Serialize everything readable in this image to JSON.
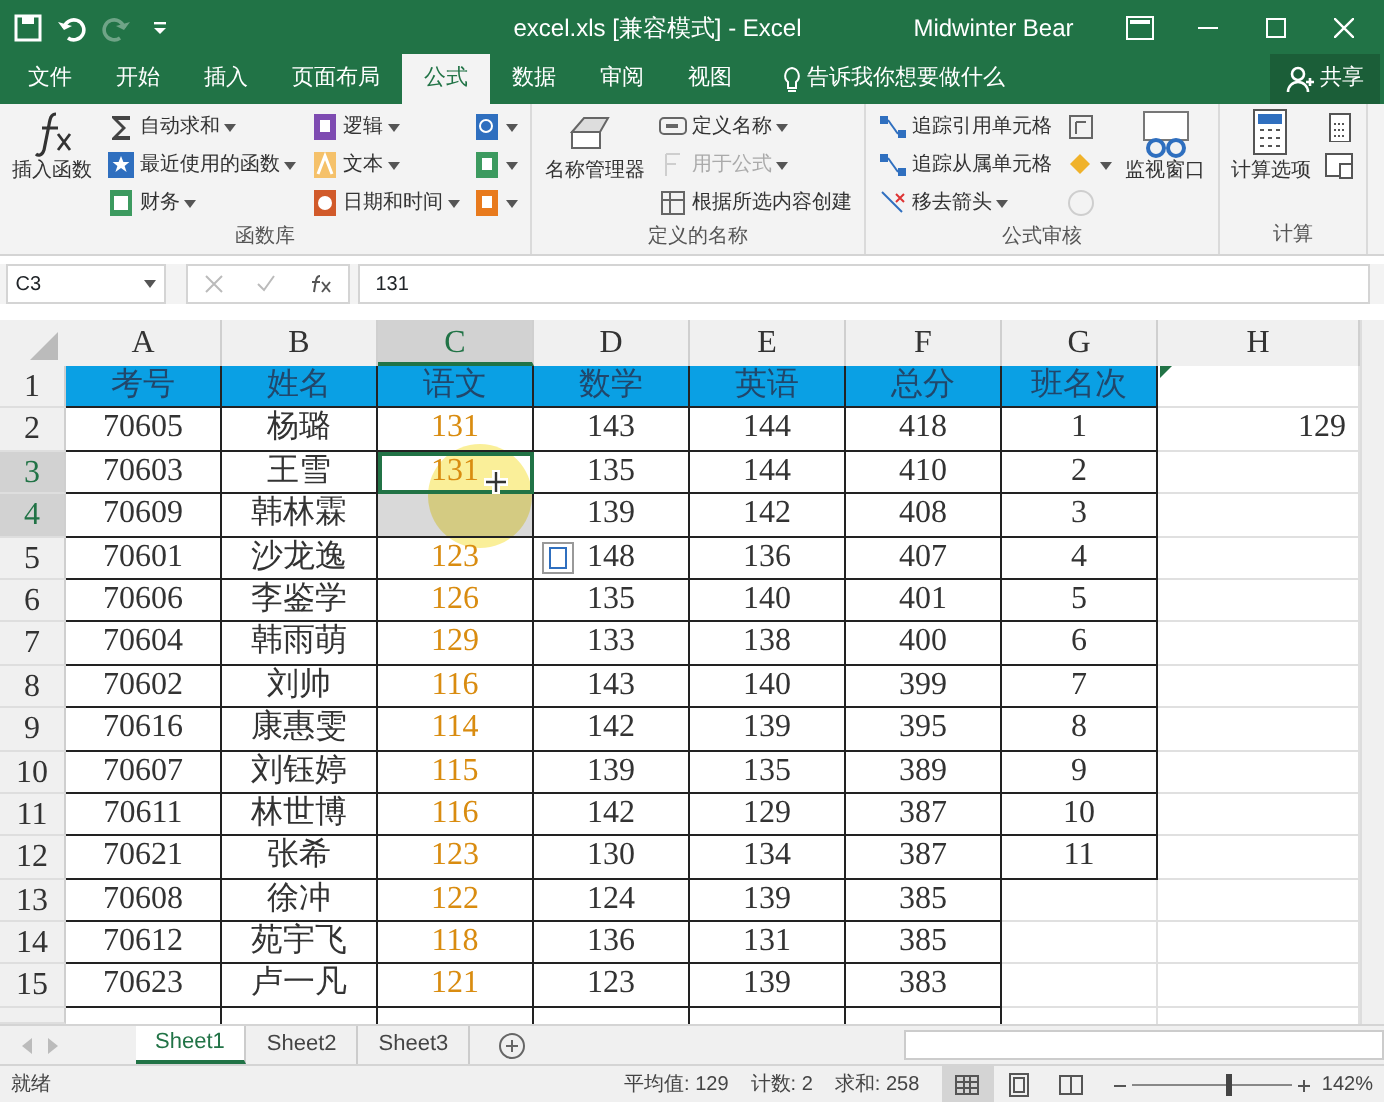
{
  "window": {
    "title": "excel.xls  [兼容模式]  -  Excel",
    "user": "Midwinter Bear"
  },
  "quick_access": [
    {
      "kind": "save",
      "disabled": false
    },
    {
      "kind": "undo",
      "disabled": false
    },
    {
      "kind": "redo",
      "disabled": true
    },
    {
      "kind": "customize",
      "disabled": false
    }
  ],
  "tabs": [
    {
      "label": "文件",
      "selected": false
    },
    {
      "label": "开始",
      "selected": false
    },
    {
      "label": "插入",
      "selected": false
    },
    {
      "label": "页面布局",
      "selected": false
    },
    {
      "label": "公式",
      "selected": true
    },
    {
      "label": "数据",
      "selected": false
    },
    {
      "label": "审阅",
      "selected": false
    },
    {
      "label": "视图",
      "selected": false
    }
  ],
  "tell_me": {
    "placeholder": "告诉我你想要做什么"
  },
  "share": "共享",
  "ribbon": [
    {
      "label": "函数库",
      "big": [
        {
          "label": "插入函数",
          "kind": "fx"
        }
      ],
      "columns": [
        [
          {
            "label": "自动求和",
            "kind": "sum",
            "dropdown": true,
            "disabled": false
          },
          {
            "label": "最近使用的函数",
            "kind": "star",
            "dropdown": true,
            "disabled": false
          },
          {
            "label": "财务",
            "kind": "book",
            "dropdown": true,
            "disabled": false
          }
        ],
        [
          {
            "label": "逻辑",
            "kind": "question",
            "dropdown": true,
            "disabled": false
          },
          {
            "label": "文本",
            "kind": "text",
            "dropdown": true,
            "disabled": false
          },
          {
            "label": "日期和时间",
            "kind": "clock",
            "dropdown": true,
            "disabled": false
          }
        ],
        [
          {
            "kind": "lookup",
            "dropdown": true,
            "disabled": false
          },
          {
            "kind": "math",
            "dropdown": true,
            "disabled": false
          },
          {
            "kind": "more",
            "dropdown": true,
            "disabled": false
          }
        ]
      ]
    },
    {
      "label": "定义的名称",
      "big": [
        {
          "label": "名称管理器",
          "kind": "names"
        }
      ],
      "columns": [
        [
          {
            "label": "定义名称",
            "kind": "tag",
            "dropdown": true,
            "disabled": false
          },
          {
            "label": "用于公式",
            "kind": "formula",
            "dropdown": true,
            "disabled": true
          },
          {
            "label": "根据所选内容创建",
            "kind": "create",
            "dropdown": false,
            "disabled": false
          }
        ]
      ]
    },
    {
      "label": "公式审核",
      "columns": [
        [
          {
            "label": "追踪引用单元格",
            "kind": "trace",
            "dropdown": false,
            "disabled": false
          },
          {
            "label": "追踪从属单元格",
            "kind": "trace",
            "dropdown": false,
            "disabled": false
          },
          {
            "label": "移去箭头",
            "kind": "remove",
            "dropdown": true,
            "disabled": false
          }
        ],
        [
          {
            "kind": "showformula",
            "dropdown": false,
            "disabled": false
          },
          {
            "kind": "check",
            "dropdown": true,
            "disabled": false
          },
          {
            "kind": "evaluate",
            "dropdown": false,
            "disabled": true
          }
        ]
      ],
      "big_after": [
        {
          "label": "监视窗口",
          "kind": "watch"
        }
      ]
    },
    {
      "label": "计算",
      "big": [
        {
          "label": "计算选项",
          "kind": "calc"
        }
      ],
      "columns": [
        [
          {
            "kind": "calcnow",
            "dropdown": false,
            "disabled": false
          },
          {
            "kind": "calcsheet",
            "dropdown": false,
            "disabled": false
          }
        ]
      ]
    }
  ],
  "formula_bar": {
    "name_box": "C3",
    "value": "131"
  },
  "columns": [
    {
      "label": "A",
      "selected": false,
      "framed": true
    },
    {
      "label": "B",
      "selected": false,
      "framed": true
    },
    {
      "label": "C",
      "selected": true,
      "framed": true,
      "color": "#d98c10"
    },
    {
      "label": "D",
      "selected": false,
      "framed": true
    },
    {
      "label": "E",
      "selected": false,
      "framed": true
    },
    {
      "label": "F",
      "selected": false,
      "framed": true
    },
    {
      "label": "G",
      "selected": false,
      "framed": true
    },
    {
      "label": "H",
      "selected": false,
      "framed": false
    }
  ],
  "rows": [
    {
      "num": "1",
      "selected": false,
      "header": true,
      "cells": [
        "考号",
        "姓名",
        "语文",
        "数学",
        "英语",
        "总分",
        "班名次"
      ]
    },
    {
      "num": "2",
      "selected": false,
      "cells": [
        "70605",
        "杨璐",
        "131",
        "143",
        "144",
        "418",
        "1",
        "129"
      ]
    },
    {
      "num": "3",
      "selected": true,
      "cells": [
        "70603",
        "王雪",
        "131",
        "135",
        "144",
        "410",
        "2"
      ]
    },
    {
      "num": "4",
      "selected": true,
      "cells": [
        "70609",
        "韩林霖",
        null,
        "139",
        "142",
        "408",
        "3"
      ]
    },
    {
      "num": "5",
      "selected": false,
      "cells": [
        "70601",
        "沙龙逸",
        "123",
        "148",
        "136",
        "407",
        "4"
      ]
    },
    {
      "num": "6",
      "selected": false,
      "cells": [
        "70606",
        "李鉴学",
        "126",
        "135",
        "140",
        "401",
        "5"
      ]
    },
    {
      "num": "7",
      "selected": false,
      "cells": [
        "70604",
        "韩雨萌",
        "129",
        "133",
        "138",
        "400",
        "6"
      ]
    },
    {
      "num": "8",
      "selected": false,
      "cells": [
        "70602",
        "刘帅",
        "116",
        "143",
        "140",
        "399",
        "7"
      ]
    },
    {
      "num": "9",
      "selected": false,
      "cells": [
        "70616",
        "康惠雯",
        "114",
        "142",
        "139",
        "395",
        "8"
      ]
    },
    {
      "num": "10",
      "selected": false,
      "cells": [
        "70607",
        "刘钰婷",
        "115",
        "139",
        "135",
        "389",
        "9"
      ]
    },
    {
      "num": "11",
      "selected": false,
      "cells": [
        "70611",
        "林世博",
        "116",
        "142",
        "129",
        "387",
        "10"
      ]
    },
    {
      "num": "12",
      "selected": false,
      "cells": [
        "70621",
        "张希",
        "123",
        "130",
        "134",
        "387",
        "11"
      ]
    },
    {
      "num": "13",
      "selected": false,
      "cells": [
        "70608",
        "徐冲",
        "122",
        "124",
        "139",
        "385"
      ]
    },
    {
      "num": "14",
      "selected": false,
      "cells": [
        "70612",
        "苑宇飞",
        "118",
        "136",
        "131",
        "385"
      ]
    },
    {
      "num": "15",
      "selected": false,
      "cells": [
        "70623",
        "卢一凡",
        "121",
        "123",
        "139",
        "383"
      ]
    }
  ],
  "sheets": [
    {
      "label": "Sheet1",
      "selected": true
    },
    {
      "label": "Sheet2",
      "selected": false
    },
    {
      "label": "Sheet3",
      "selected": false
    }
  ],
  "status_bar": {
    "state": "就绪",
    "stats": [
      "平均值: 129",
      "计数: 2",
      "求和: 258"
    ],
    "views": [
      {
        "kind": "normal",
        "selected": true
      },
      {
        "kind": "layout",
        "selected": false
      },
      {
        "kind": "pagebreak",
        "selected": false
      }
    ],
    "zoom": {
      "level": 0.6,
      "reading": "142%"
    }
  }
}
